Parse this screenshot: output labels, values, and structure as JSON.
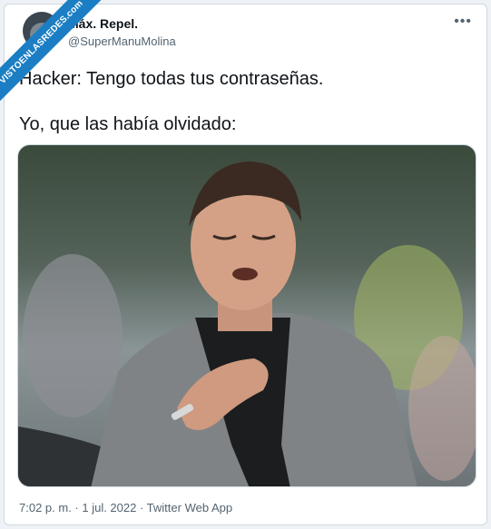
{
  "watermark": {
    "text": "VISTOENLASREDES",
    "suffix": ".com"
  },
  "tweet": {
    "display_name": "Máx. Repel.",
    "handle": "@SuperManuMolina",
    "more_icon": "more-options-icon",
    "text_line1": "Hacker: Tengo todas tus contraseñas.",
    "text_line2": "Yo, que las había olvidado:",
    "timestamp": "7:02 p. m. · 1 jul. 2022 · Twitter Web App"
  },
  "colors": {
    "banner": "#1b7ec4",
    "text": "#0f1419",
    "muted": "#536471"
  }
}
